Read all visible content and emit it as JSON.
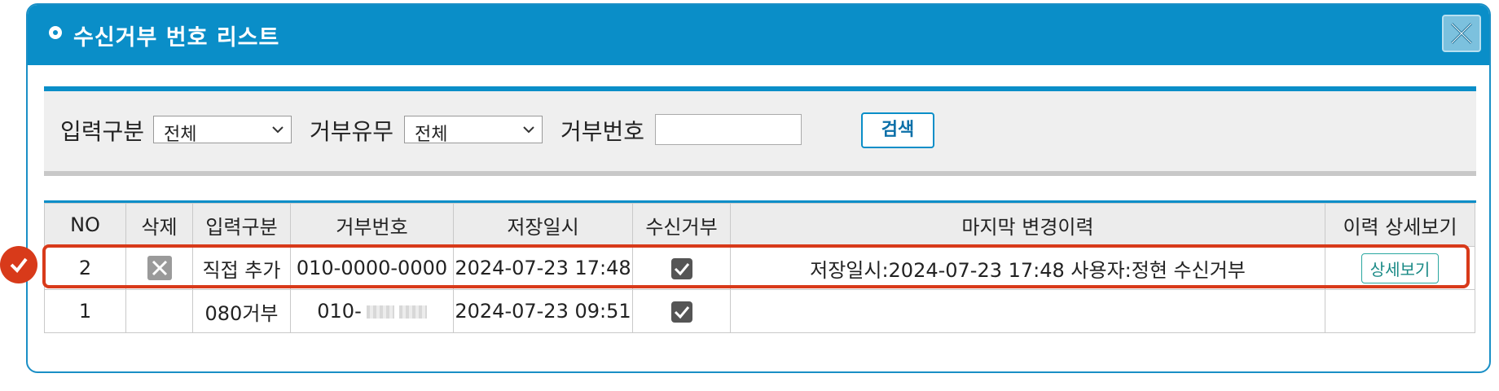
{
  "dialog": {
    "title": "수신거부 번호 리스트",
    "close_icon": "close-icon"
  },
  "search": {
    "input_type_label": "입력구분",
    "input_type_value": "전체",
    "reject_flag_label": "거부유무",
    "reject_flag_value": "전체",
    "reject_number_label": "거부번호",
    "reject_number_value": "",
    "search_button": "검색"
  },
  "table": {
    "headers": [
      "NO",
      "삭제",
      "입력구분",
      "거부번호",
      "저장일시",
      "수신거부",
      "마지막 변경이력",
      "이력 상세보기"
    ],
    "rows": [
      {
        "no": "2",
        "delete_icon": "delete-icon",
        "input_type": "직접 추가",
        "number": "010-0000-0000",
        "saved_at": "2024-07-23 17:48",
        "rejected": true,
        "last_change": "저장일시:2024-07-23 17:48 사용자:정현 수신거부",
        "detail_button": "상세보기"
      },
      {
        "no": "1",
        "input_type": "080거부",
        "number": "010-",
        "saved_at": "2024-07-23 09:51",
        "rejected": true,
        "last_change": ""
      }
    ]
  },
  "colors": {
    "accent": "#0a8ec8",
    "highlight": "#d83a1a"
  }
}
